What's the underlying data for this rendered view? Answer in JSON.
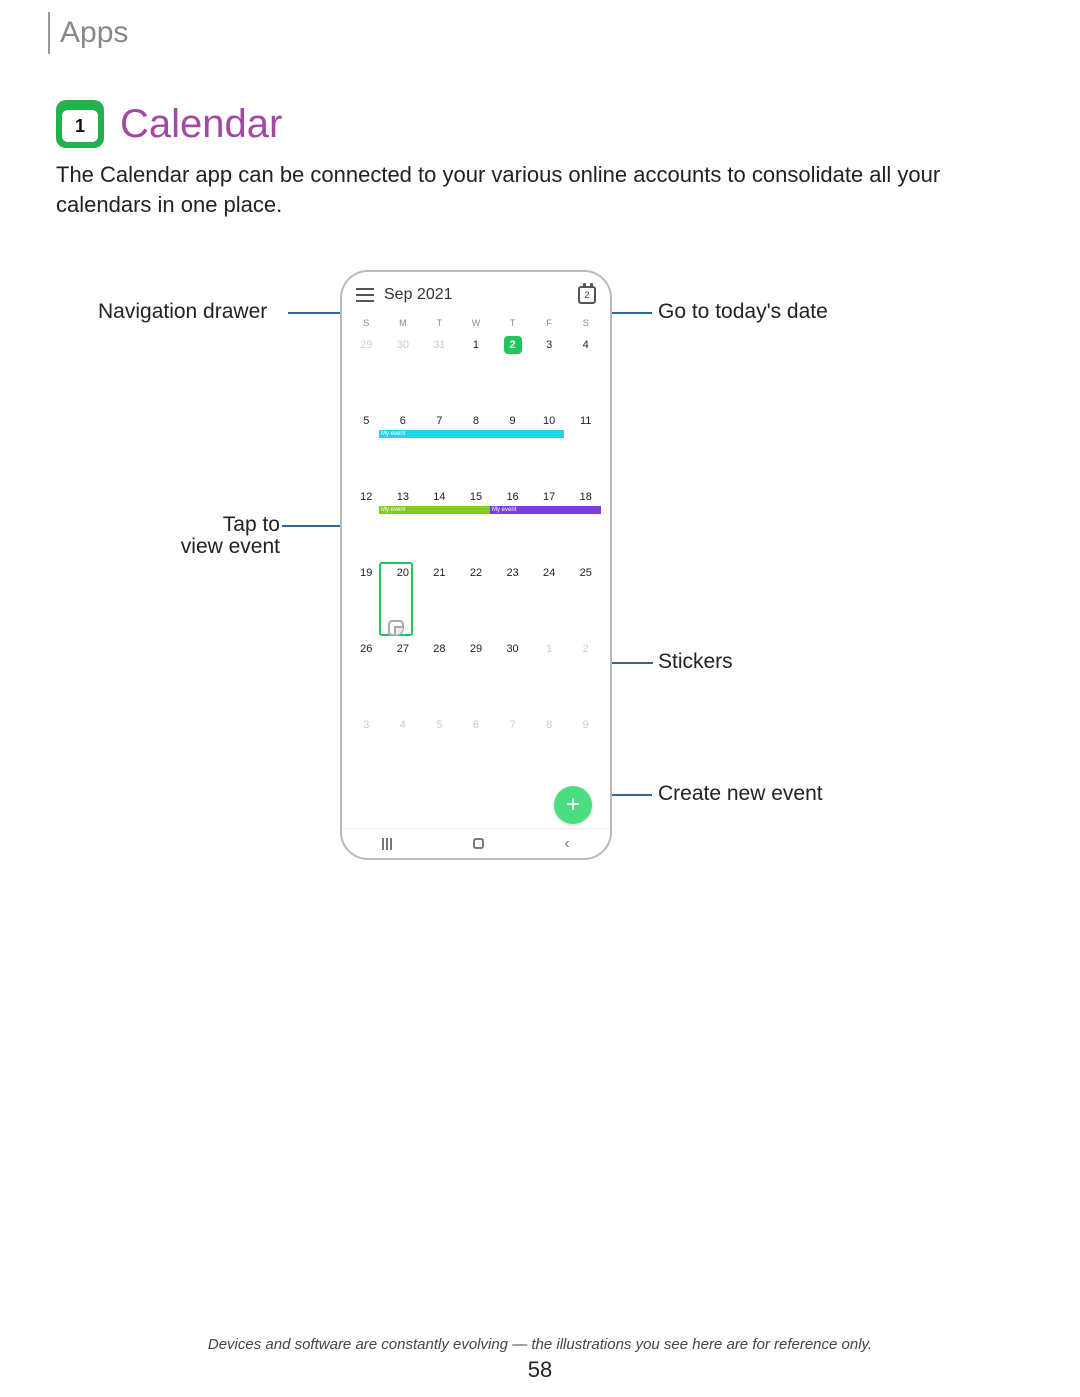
{
  "section": "Apps",
  "app_icon_num": "1",
  "title": "Calendar",
  "intro": "The Calendar app can be connected to your various online accounts to consolidate all your calendars in one place.",
  "phone": {
    "month": "Sep 2021",
    "today_badge": "2",
    "dow": [
      "S",
      "M",
      "T",
      "W",
      "T",
      "F",
      "S"
    ],
    "weeks": [
      [
        {
          "n": "29",
          "pad": true
        },
        {
          "n": "30",
          "pad": true
        },
        {
          "n": "31",
          "pad": true
        },
        {
          "n": "1"
        },
        {
          "n": "2",
          "today": true
        },
        {
          "n": "3"
        },
        {
          "n": "4"
        }
      ],
      [
        {
          "n": "5"
        },
        {
          "n": "6"
        },
        {
          "n": "7"
        },
        {
          "n": "8"
        },
        {
          "n": "9"
        },
        {
          "n": "10"
        },
        {
          "n": "11"
        }
      ],
      [
        {
          "n": "12"
        },
        {
          "n": "13"
        },
        {
          "n": "14"
        },
        {
          "n": "15"
        },
        {
          "n": "16"
        },
        {
          "n": "17"
        },
        {
          "n": "18"
        }
      ],
      [
        {
          "n": "19"
        },
        {
          "n": "20"
        },
        {
          "n": "21"
        },
        {
          "n": "22"
        },
        {
          "n": "23"
        },
        {
          "n": "24"
        },
        {
          "n": "25"
        }
      ],
      [
        {
          "n": "26"
        },
        {
          "n": "27"
        },
        {
          "n": "28"
        },
        {
          "n": "29"
        },
        {
          "n": "30"
        },
        {
          "n": "1",
          "pad": true
        },
        {
          "n": "2",
          "pad": true
        }
      ],
      [
        {
          "n": "3",
          "pad": true
        },
        {
          "n": "4",
          "pad": true
        },
        {
          "n": "5",
          "pad": true
        },
        {
          "n": "6",
          "pad": true
        },
        {
          "n": "7",
          "pad": true
        },
        {
          "n": "8",
          "pad": true
        },
        {
          "n": "9",
          "pad": true
        }
      ]
    ],
    "event_label": "My event"
  },
  "callouts": {
    "nav_drawer": "Navigation drawer",
    "today": "Go to today's date",
    "tap_line1": "Tap to",
    "tap_line2": "view event",
    "stickers": "Stickers",
    "create": "Create new event"
  },
  "disclaimer": "Devices and software are constantly evolving — the illustrations you see here are for reference only.",
  "page": "58"
}
